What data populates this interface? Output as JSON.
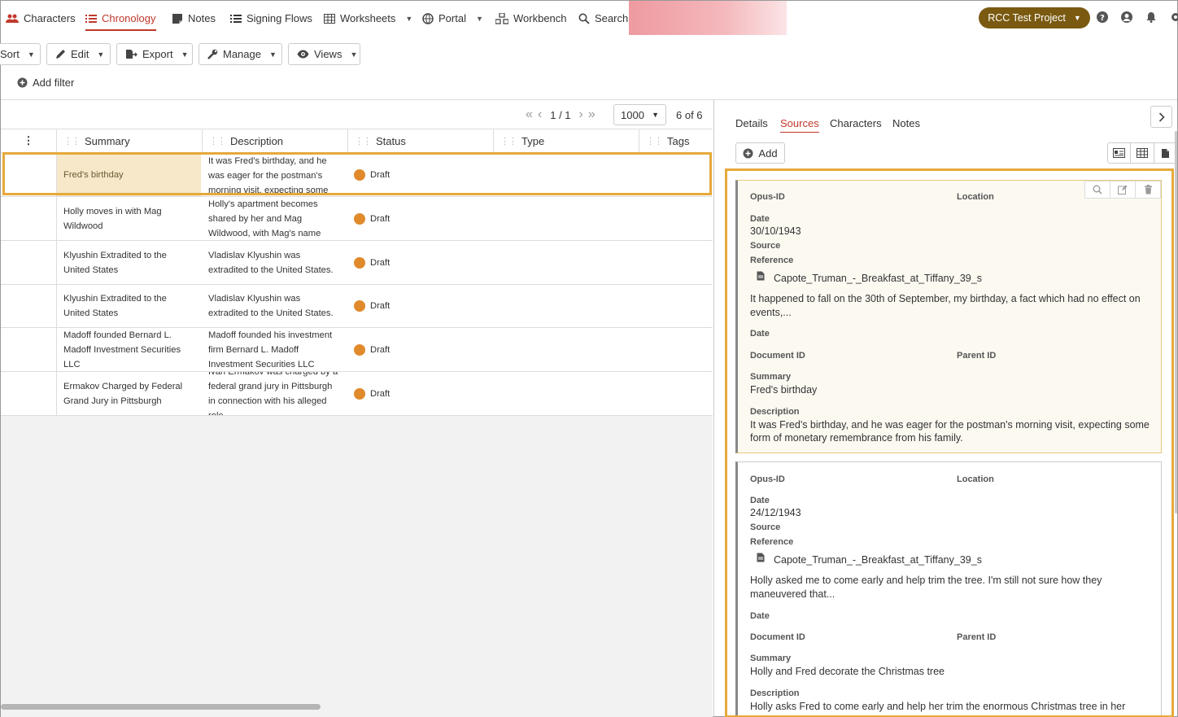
{
  "nav": {
    "items": [
      {
        "label": "Characters",
        "icon": "users-icon"
      },
      {
        "label": "Chronology",
        "icon": "list-icon",
        "active": true
      },
      {
        "label": "Notes",
        "icon": "note-icon"
      },
      {
        "label": "Signing Flows",
        "icon": "list-icon"
      },
      {
        "label": "Worksheets",
        "icon": "table-icon"
      },
      {
        "label": "Portal",
        "icon": "globe-icon"
      },
      {
        "label": "Workbench",
        "icon": "workbench-icon"
      },
      {
        "label": "Search",
        "icon": "search-icon"
      }
    ],
    "project": "RCC Test Project"
  },
  "toolbar": {
    "sort": "Sort",
    "edit": "Edit",
    "export": "Export",
    "manage": "Manage",
    "views": "Views",
    "add_filter": "Add filter"
  },
  "grid": {
    "pager": {
      "page": "1 / 1",
      "page_size": "1000",
      "count": "6 of 6"
    },
    "columns": [
      "Summary",
      "Description",
      "Status",
      "Type",
      "Tags"
    ],
    "rows": [
      {
        "summary": "Fred's birthday",
        "description": "It was Fred's birthday, and he was eager for the postman's morning visit, expecting some form of",
        "status": "Draft"
      },
      {
        "summary": "Holly moves in with Mag Wildwood",
        "description": "Holly's apartment becomes shared by her and Mag Wildwood, with Mag's name",
        "status": "Draft"
      },
      {
        "summary": "Klyushin Extradited to the United States",
        "description": "Vladislav Klyushin was extradited to the United States.",
        "status": "Draft"
      },
      {
        "summary": "Klyushin Extradited to the United States",
        "description": "Vladislav Klyushin was extradited to the United States.",
        "status": "Draft"
      },
      {
        "summary": "Madoff founded Bernard L. Madoff Investment Securities LLC",
        "description": "Madoff founded his investment firm Bernard L. Madoff Investment Securities LLC",
        "status": "Draft"
      },
      {
        "summary": "Ermakov Charged by Federal Grand Jury in Pittsburgh",
        "description": "Ivan Ermakov was charged by a federal grand jury in Pittsburgh in connection with his alleged role",
        "status": "Draft"
      }
    ]
  },
  "panel": {
    "tabs": [
      "Details",
      "Sources",
      "Characters",
      "Notes"
    ],
    "active_tab": "Sources",
    "add_label": "Add",
    "labels": {
      "opus_id": "Opus-ID",
      "location": "Location",
      "date": "Date",
      "source": "Source",
      "reference": "Reference",
      "document_id": "Document ID",
      "parent_id": "Parent ID",
      "summary": "Summary",
      "description": "Description"
    },
    "sources": [
      {
        "date": "30/10/1943",
        "reference": "Capote_Truman_-_Breakfast_at_Tiffany_39_s",
        "quote": "It happened to fall on the 30th of September, my birthday, a fact which had no effect on events,...",
        "summary": "Fred's birthday",
        "description": "It was Fred's birthday, and he was eager for the postman's morning visit, expecting some form of monetary remembrance from his family."
      },
      {
        "date": "24/12/1943",
        "reference": "Capote_Truman_-_Breakfast_at_Tiffany_39_s",
        "quote": "Holly asked me to come early and help trim the tree. I'm still not sure how they maneuvered that...",
        "summary": "Holly and Fred decorate the Christmas tree",
        "description": "Holly asks Fred to come early and help her trim the enormous Christmas tree in her"
      }
    ]
  },
  "colors": {
    "accent": "#c0392b",
    "project": "#7a5a10",
    "highlight": "#e6a93a",
    "draft": "#e08a2c"
  }
}
